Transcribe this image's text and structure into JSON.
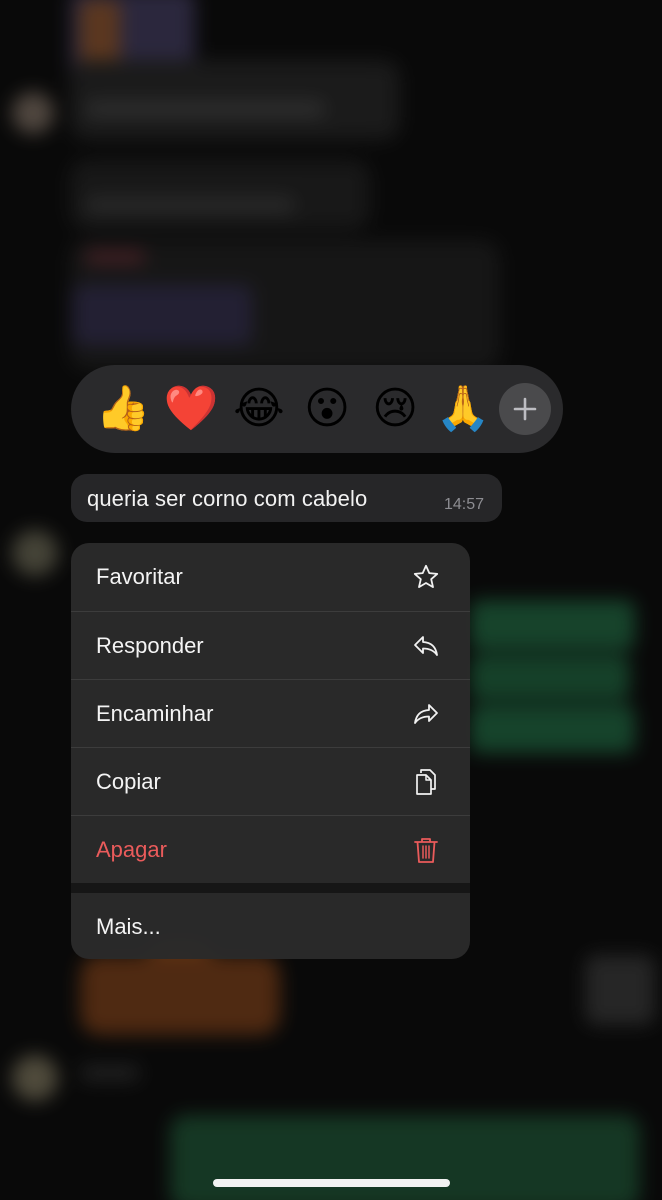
{
  "reactions": {
    "items": [
      {
        "emoji": "👍",
        "name": "thumbs-up"
      },
      {
        "emoji": "❤️",
        "name": "red-heart"
      },
      {
        "emoji": "😂",
        "name": "tears-of-joy"
      },
      {
        "emoji": "😮",
        "name": "surprised"
      },
      {
        "emoji": "😢",
        "name": "crying"
      },
      {
        "emoji": "🙏",
        "name": "folded-hands"
      }
    ],
    "more_icon": "plus-icon"
  },
  "message": {
    "text": "queria ser corno com cabelo",
    "time": "14:57"
  },
  "menu": {
    "favoritar": {
      "label": "Favoritar",
      "icon": "star-icon"
    },
    "responder": {
      "label": "Responder",
      "icon": "reply-icon"
    },
    "encaminhar": {
      "label": "Encaminhar",
      "icon": "forward-icon"
    },
    "copiar": {
      "label": "Copiar",
      "icon": "copy-icon"
    },
    "apagar": {
      "label": "Apagar",
      "icon": "trash-icon",
      "color": "#ea5b5b"
    },
    "mais": {
      "label": "Mais..."
    }
  },
  "colors": {
    "menu_background": "#2a2a2a",
    "reaction_bar_background": "#2c2c2e",
    "bubble_background": "#262628",
    "danger": "#ea5b5b"
  }
}
